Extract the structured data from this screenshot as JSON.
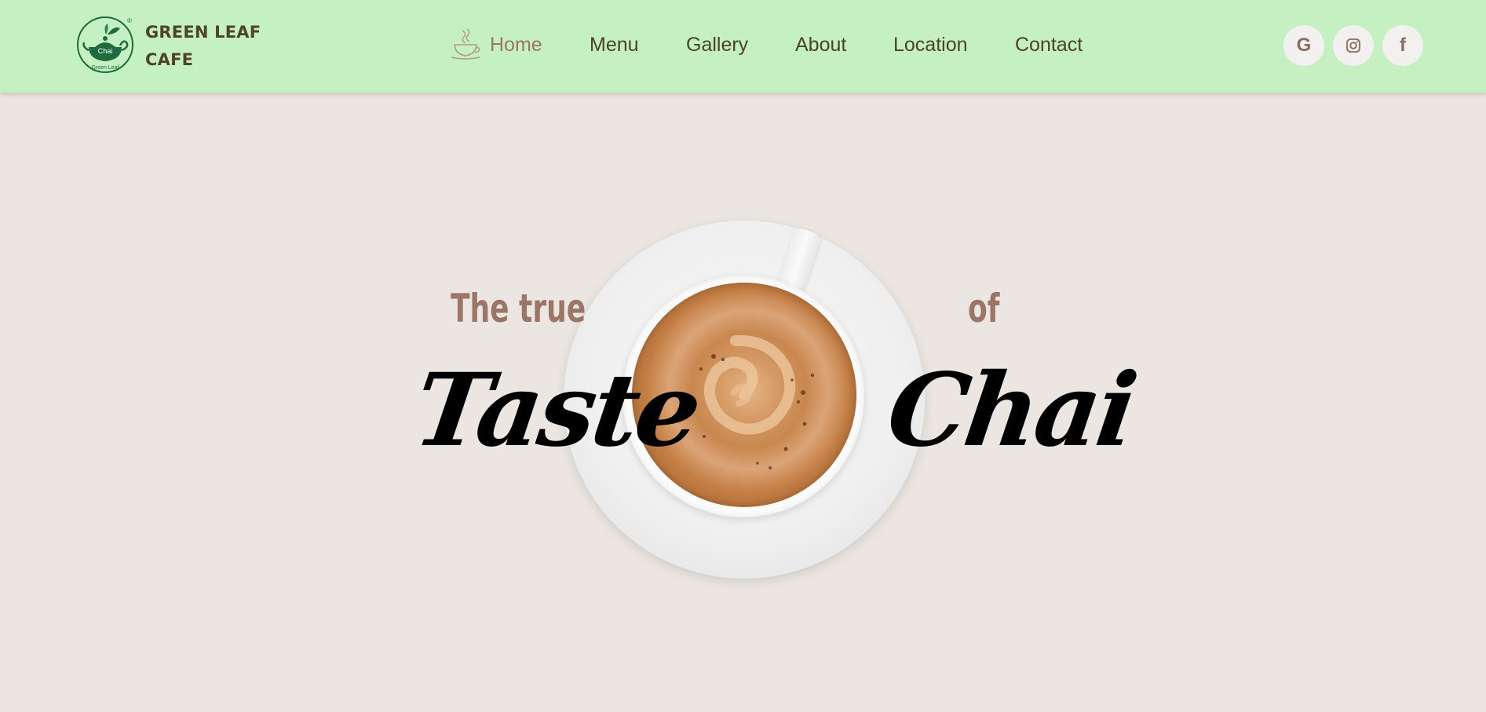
{
  "header": {
    "brand_line1": "GREEN LEAF",
    "brand_line2": "CAFE",
    "logo": {
      "text_center": "Chai",
      "text_bottom": "Green Leaf",
      "mark": "®",
      "color": "#1f6b3f"
    },
    "nav": [
      {
        "label": "Home",
        "active": true
      },
      {
        "label": "Menu",
        "active": false
      },
      {
        "label": "Gallery",
        "active": false
      },
      {
        "label": "About",
        "active": false
      },
      {
        "label": "Location",
        "active": false
      },
      {
        "label": "Contact",
        "active": false
      }
    ],
    "social": [
      {
        "icon": "google-icon",
        "glyph": "G"
      },
      {
        "icon": "instagram-icon"
      },
      {
        "icon": "facebook-icon",
        "glyph": "f"
      }
    ]
  },
  "hero": {
    "line1_left": "The true",
    "line1_right": "of",
    "line2_left": "Taste",
    "line2_right": "Chai"
  },
  "colors": {
    "header_bg": "#c4f0c2",
    "page_bg": "#ebe6e2",
    "nav_text": "#4b4422",
    "accent": "#9b7667",
    "brand_text": "#4f4423"
  }
}
